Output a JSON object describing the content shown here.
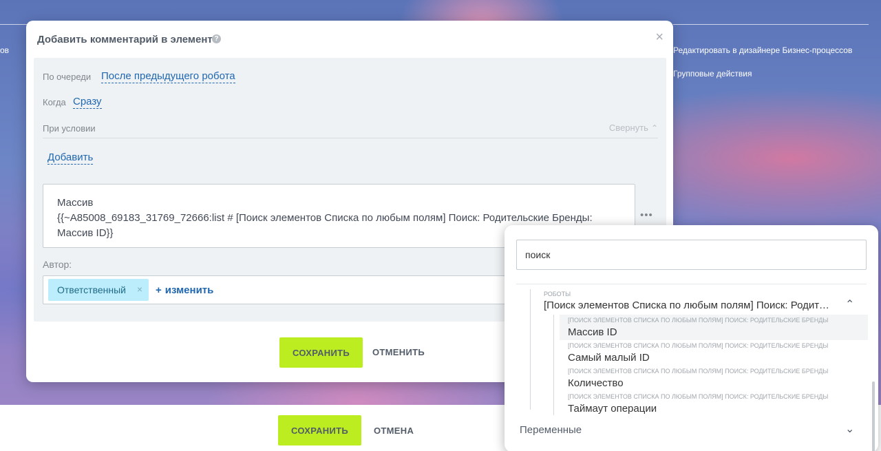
{
  "background": {
    "left_fragment": "ов",
    "links": [
      "Редактировать в дизайнере Бизнес-процессов",
      "Групповые действия"
    ]
  },
  "bottom_bar": {
    "save_label": "СОХРАНИТЬ",
    "cancel_label": "ОТМЕНА"
  },
  "dialog": {
    "title": "Добавить комментарий в элемент",
    "help_glyph": "?",
    "close_glyph": "×",
    "queue_label": "По очереди",
    "queue_value": "После предыдущего робота",
    "when_label": "Когда",
    "when_value": "Сразу",
    "condition_label": "При условии",
    "collapse_label": "Свернуть",
    "add_label": "Добавить",
    "text_lines": [
      "Массив",
      "{{~A85008_69183_31769_72666:list # [Поиск элементов Списка по любым полям] Поиск: Родительские Бренды:",
      "Массив ID}}"
    ],
    "more_glyph": "•••",
    "author_label": "Автор:",
    "author_tag": "Ответственный",
    "change_label": "изменить",
    "save_label": "СОХРАНИТЬ",
    "cancel_label": "ОТМЕНИТЬ"
  },
  "popup": {
    "search_value": "поиск",
    "group_title": "РОБОТЫ",
    "group_name": "[Поиск элементов Списка по любым полям] Поиск: Родительские Бренды",
    "items": [
      {
        "sup": "[ПОИСК ЭЛЕМЕНТОВ СПИСКА ПО ЛЮБЫМ ПОЛЯМ] ПОИСК: РОДИТЕЛЬСКИЕ БРЕНДЫ",
        "label": "Массив ID"
      },
      {
        "sup": "[ПОИСК ЭЛЕМЕНТОВ СПИСКА ПО ЛЮБЫМ ПОЛЯМ] ПОИСК: РОДИТЕЛЬСКИЕ БРЕНДЫ",
        "label": "Самый малый ID"
      },
      {
        "sup": "[ПОИСК ЭЛЕМЕНТОВ СПИСКА ПО ЛЮБЫМ ПОЛЯМ] ПОИСК: РОДИТЕЛЬСКИЕ БРЕНДЫ",
        "label": "Количество"
      },
      {
        "sup": "[ПОИСК ЭЛЕМЕНТОВ СПИСКА ПО ЛЮБЫМ ПОЛЯМ] ПОИСК: РОДИТЕЛЬСКИЕ БРЕНДЫ",
        "label": "Таймаут операции"
      }
    ],
    "variables_label": "Переменные"
  },
  "colors": {
    "accent_green": "#bbed21",
    "link_blue": "#2067b0",
    "tag_bg": "#bcedfc"
  }
}
